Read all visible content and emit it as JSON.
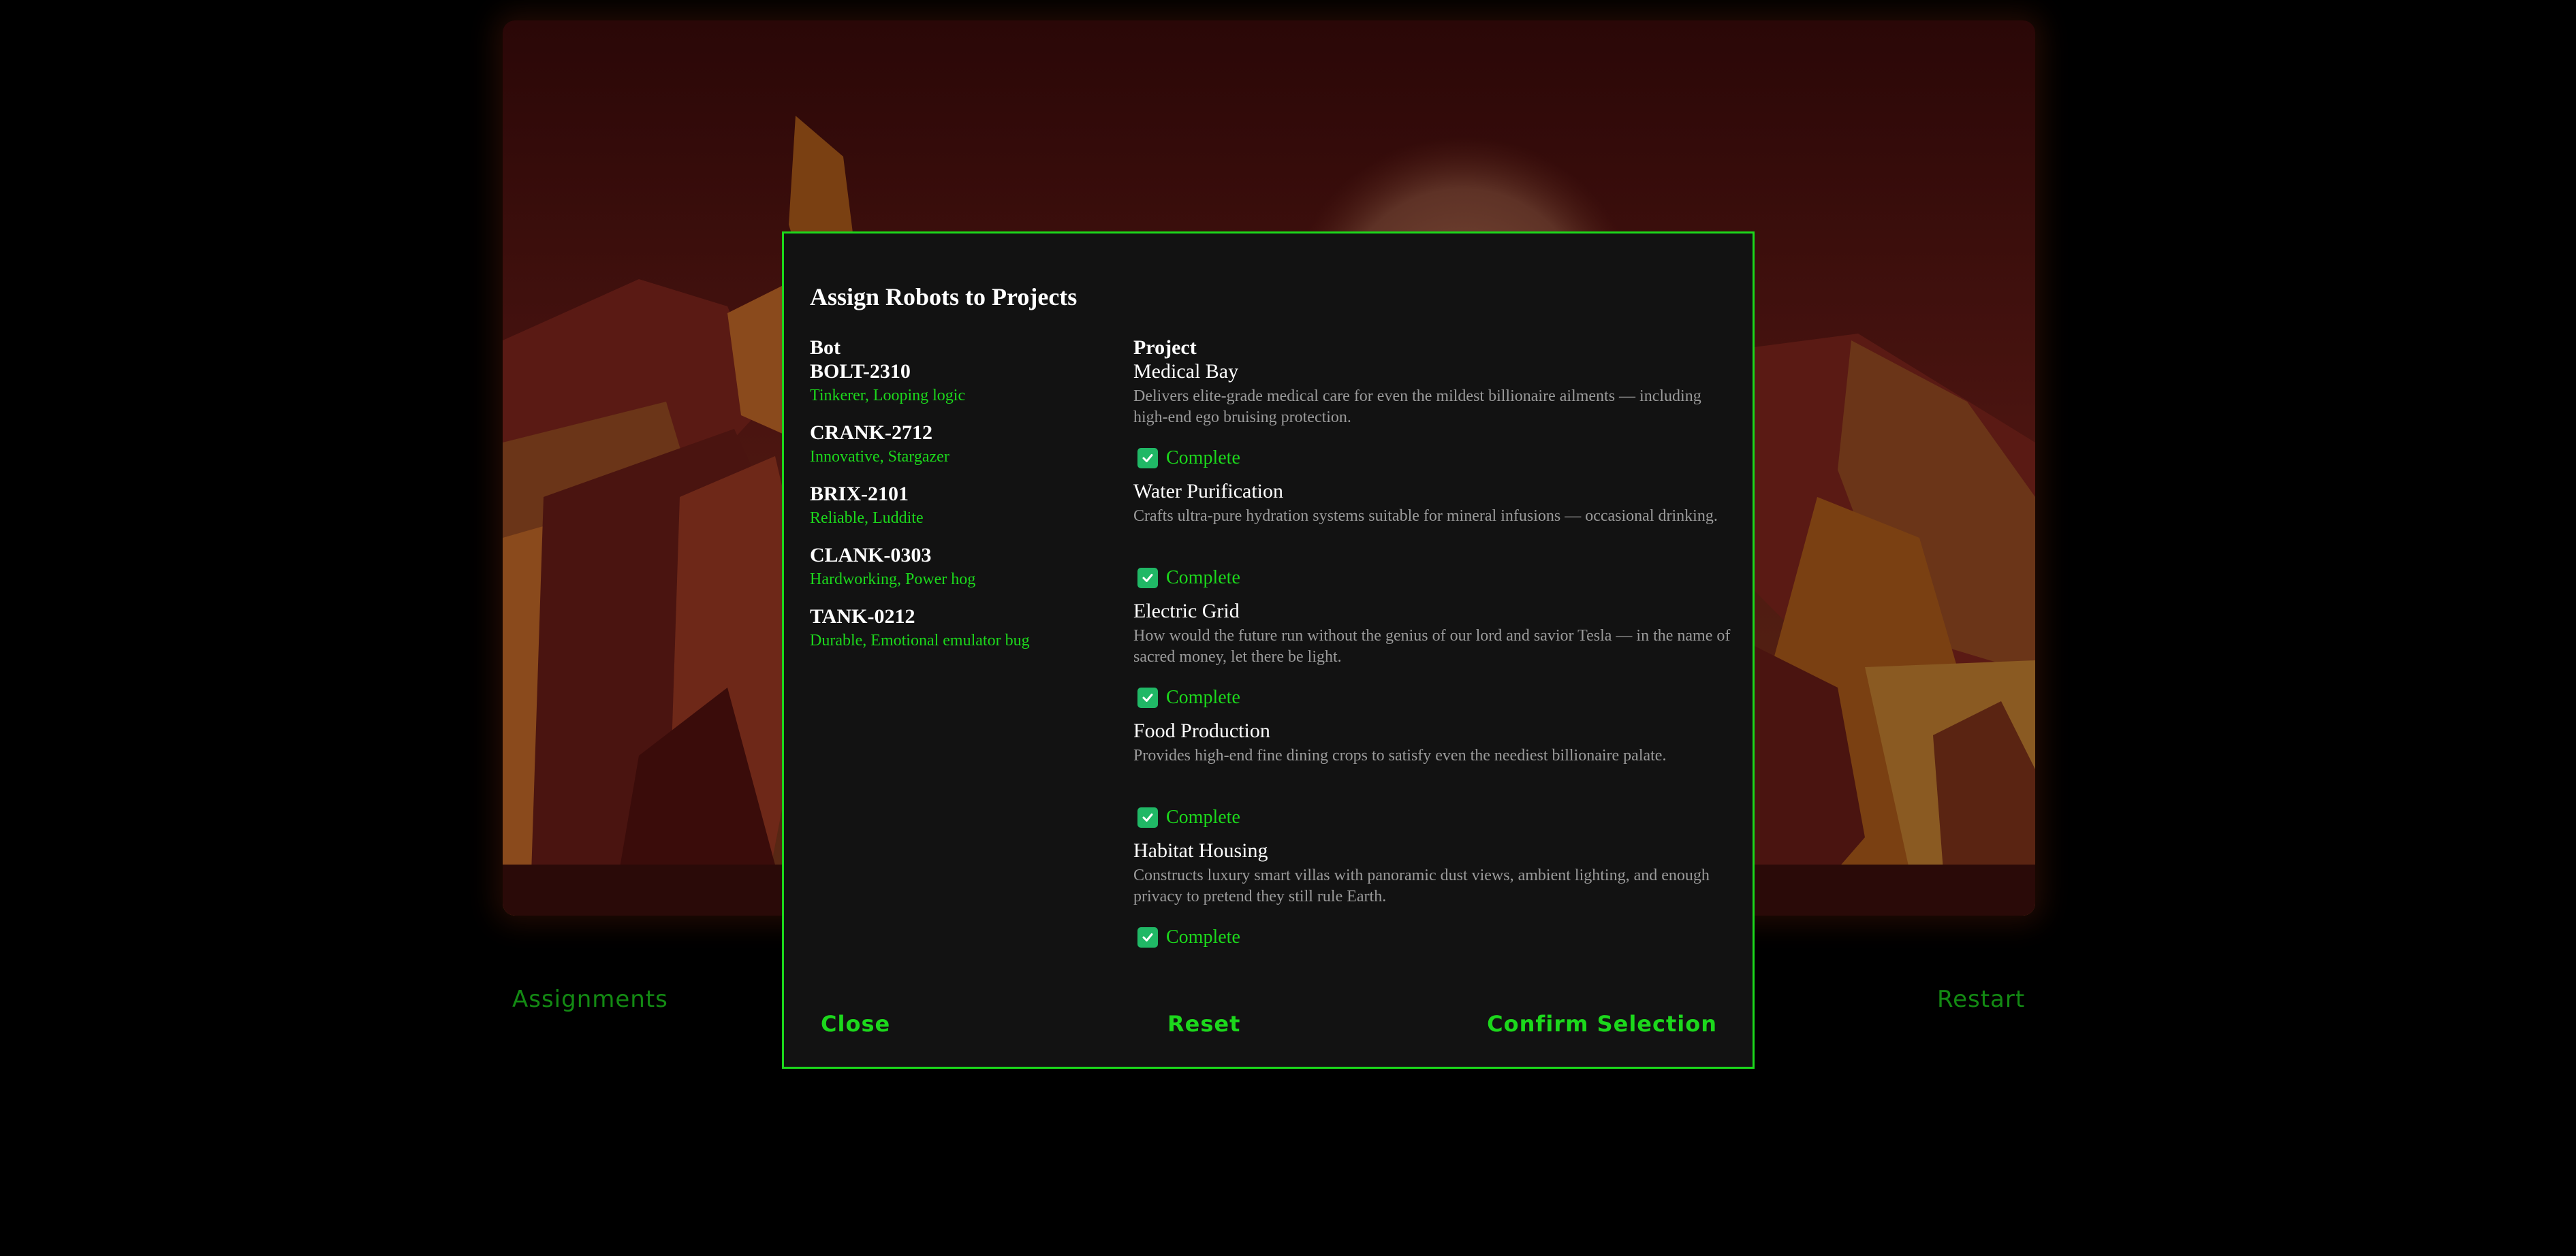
{
  "bottom_bar": {
    "assignments_label": "Assignments",
    "restart_label": "Restart"
  },
  "modal": {
    "title": "Assign Robots to Projects",
    "bots_header": "Bot",
    "projects_header": "Project",
    "bots": [
      {
        "name": "BOLT-2310",
        "traits": "Tinkerer, Looping logic"
      },
      {
        "name": "CRANK-2712",
        "traits": "Innovative, Stargazer"
      },
      {
        "name": "BRIX-2101",
        "traits": "Reliable, Luddite"
      },
      {
        "name": "CLANK-0303",
        "traits": "Hardworking, Power hog"
      },
      {
        "name": "TANK-0212",
        "traits": "Durable, Emotional emulator bug"
      }
    ],
    "projects": [
      {
        "name": "Medical Bay",
        "description": "Delivers elite-grade medical care for even the mildest billionaire ailments — including high-end ego bruising protection.",
        "status": "Complete",
        "checked": true
      },
      {
        "name": "Water Purification",
        "description": "Crafts ultra-pure hydration systems suitable for mineral infusions — occasional drinking.",
        "status": "Complete",
        "checked": true
      },
      {
        "name": "Electric Grid",
        "description": "How would the future run without the genius of our lord and savior Tesla — in the name of sacred money, let there be light.",
        "status": "Complete",
        "checked": true
      },
      {
        "name": "Food Production",
        "description": "Provides high-end fine dining crops to satisfy even the neediest billionaire palate.",
        "status": "Complete",
        "checked": true
      },
      {
        "name": "Habitat Housing",
        "description": "Constructs luxury smart villas with panoramic dust views, ambient lighting, and enough privacy to pretend they still rule Earth.",
        "status": "Complete",
        "checked": true
      }
    ],
    "buttons": {
      "close": "Close",
      "reset": "Reset",
      "confirm": "Confirm Selection"
    }
  },
  "colors": {
    "accent": "#1cd81c",
    "checkbox": "#20b866",
    "modal_bg": "#121212",
    "page_bg": "#000000"
  }
}
